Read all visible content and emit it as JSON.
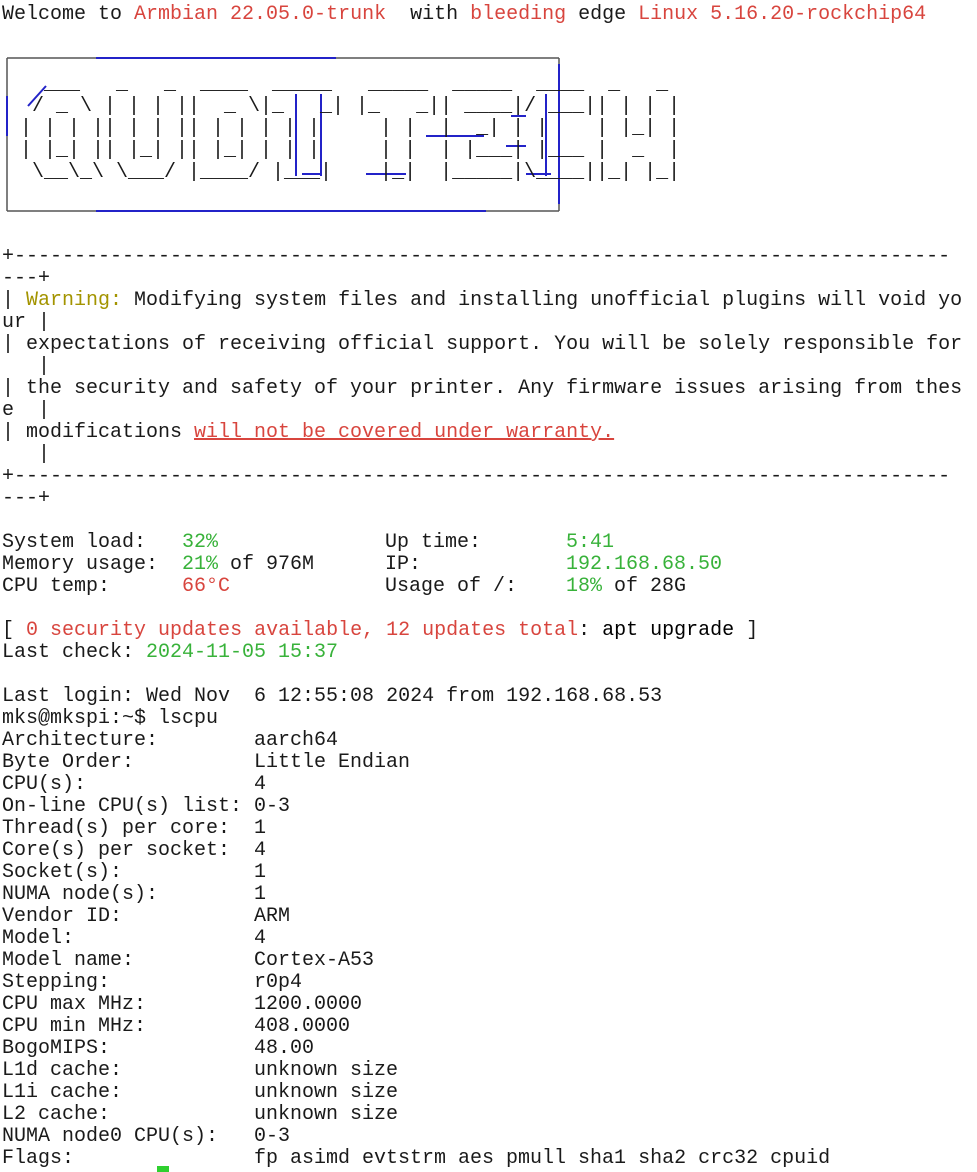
{
  "motd": {
    "welcome": {
      "prefix": "Welcome to ",
      "distro": "Armbian 22.05.0-trunk",
      "middle": "  with ",
      "bleeding": "bleeding",
      "edge": " edge ",
      "kernel": "Linux 5.16.20-rockchip64"
    },
    "logo": {
      "lines": [
        "   ___   _   _  ____  _____   _____  _____  ____  _   _ ",
        "  / _ \\ | | | ||  _ \\|_   _| |_   _|| ____|/ ___|| | | |",
        " | | | || | | || | | | | |     | |  |  _| | |    | |_| |",
        " | |_| || |_| || |_| | | |     | |  | |___| |___ |  _  |",
        "  \\__\\_\\ \\___/ |____/ |___|    |_|  |_____|\\____||_| |_|"
      ],
      "accent_color": "#2323c8"
    },
    "warning": {
      "border_top_1": "+------------------------------------------------------------------------------",
      "border_top_2": "---+",
      "label": "Warning:",
      "line1_prefix": "| ",
      "line1_rest": " Modifying system files and installing unofficial plugins will void yo",
      "line1_wrap": "ur |",
      "line2": "| expectations of receiving official support. You will be solely responsible for",
      "line2_wrap": "   |",
      "line3": "| the security and safety of your printer. Any firmware issues arising from thes",
      "line3_wrap": "e  |",
      "line4_prefix": "| modifications ",
      "line4_link": "will not be covered under warranty.",
      "line4_wrap": "   |",
      "border_bottom_1": "+------------------------------------------------------------------------------",
      "border_bottom_2": "---+"
    },
    "stats": {
      "system_load_label": "System load:",
      "system_load_value": "32%",
      "up_time_label": "Up time:",
      "up_time_value": "5:41",
      "memory_label": "Memory usage:",
      "memory_value": "21%",
      "memory_suffix": " of 976M",
      "ip_label": "IP:",
      "ip_value": "192.168.68.50",
      "cpu_temp_label": "CPU temp:",
      "cpu_temp_value": "66°C",
      "usage_label": "Usage of /:",
      "usage_value": "18%",
      "usage_suffix": " of 28G"
    },
    "updates": {
      "open": "[ ",
      "security_count": "0",
      "security_text": " security updates available, ",
      "total_count": "12",
      "total_text": " updates total",
      "colon": ": ",
      "command": "apt upgrade",
      "close": " ]"
    },
    "last_check": {
      "label": "Last check: ",
      "value": "2024-11-05 15:37"
    }
  },
  "session": {
    "last_login": "Last login: Wed Nov  6 12:55:08 2024 from 192.168.68.53",
    "prompt": "mks@mkspi:~$ ",
    "command": "lscpu"
  },
  "lscpu": [
    {
      "key": "Architecture:",
      "value": "aarch64"
    },
    {
      "key": "Byte Order:",
      "value": "Little Endian"
    },
    {
      "key": "CPU(s):",
      "value": "4"
    },
    {
      "key": "On-line CPU(s) list:",
      "value": "0-3"
    },
    {
      "key": "Thread(s) per core:",
      "value": "1"
    },
    {
      "key": "Core(s) per socket:",
      "value": "4"
    },
    {
      "key": "Socket(s):",
      "value": "1"
    },
    {
      "key": "NUMA node(s):",
      "value": "1"
    },
    {
      "key": "Vendor ID:",
      "value": "ARM"
    },
    {
      "key": "Model:",
      "value": "4"
    },
    {
      "key": "Model name:",
      "value": "Cortex-A53"
    },
    {
      "key": "Stepping:",
      "value": "r0p4"
    },
    {
      "key": "CPU max MHz:",
      "value": "1200.0000"
    },
    {
      "key": "CPU min MHz:",
      "value": "408.0000"
    },
    {
      "key": "BogoMIPS:",
      "value": "48.00"
    },
    {
      "key": "L1d cache:",
      "value": "unknown size"
    },
    {
      "key": "L1i cache:",
      "value": "unknown size"
    },
    {
      "key": "L2 cache:",
      "value": "unknown size"
    },
    {
      "key": "NUMA node0 CPU(s):",
      "value": "0-3"
    },
    {
      "key": "Flags:",
      "value": "fp asimd evtstrm aes pmull sha1 sha2 crc32 cpuid"
    }
  ],
  "colors": {
    "background": "#ffffff",
    "text": "#1a1a1a",
    "red": "#d8453e",
    "green": "#38b23a",
    "warning_yellow": "#a39400",
    "cursor": "#2fd02f"
  }
}
